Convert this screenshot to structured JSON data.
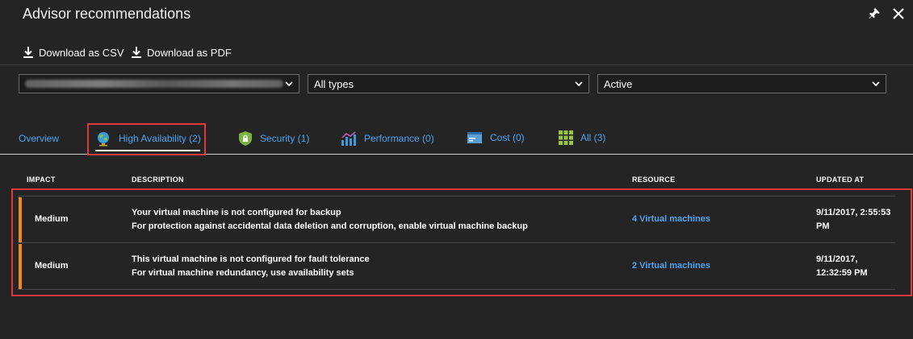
{
  "window": {
    "title": "Advisor recommendations",
    "pin_icon": "pin-icon",
    "close_icon": "close-icon"
  },
  "toolbar": {
    "download_csv_label": "Download as CSV",
    "download_pdf_label": "Download as PDF",
    "icon": "download-icon"
  },
  "filters": {
    "subscription_icon": "chevron-down-icon",
    "type_value": "All types",
    "status_value": "Active"
  },
  "tabs": [
    {
      "label": "Overview",
      "icon": ""
    },
    {
      "label": "High Availability (2)",
      "icon": "globe-icon"
    },
    {
      "label": "Security (1)",
      "icon": "shield-lock-icon"
    },
    {
      "label": "Performance (0)",
      "icon": "bar-chart-icon"
    },
    {
      "label": "Cost (0)",
      "icon": "cost-card-icon"
    },
    {
      "label": "All (3)",
      "icon": "grid-icon"
    }
  ],
  "table": {
    "columns": [
      "IMPACT",
      "DESCRIPTION",
      "RESOURCE",
      "UPDATED AT"
    ],
    "rows": [
      {
        "impact": "Medium",
        "title": "Your virtual machine is not configured for backup",
        "detail": "For protection against accidental data deletion and corruption, enable virtual machine backup",
        "resource": "4 Virtual machines",
        "updated_line1": "9/11/2017, 2:55:53",
        "updated_line2": "PM"
      },
      {
        "impact": "Medium",
        "title": "This virtual machine is not configured for fault tolerance",
        "detail": "For virtual machine redundancy, use availability sets",
        "resource": "2 Virtual machines",
        "updated_line1": "9/11/2017,",
        "updated_line2": "12:32:59 PM"
      }
    ]
  },
  "colors": {
    "background": "#242424",
    "link": "#4fa3ef",
    "impact_medium": "#f0891e",
    "highlight": "#e03a3e"
  }
}
